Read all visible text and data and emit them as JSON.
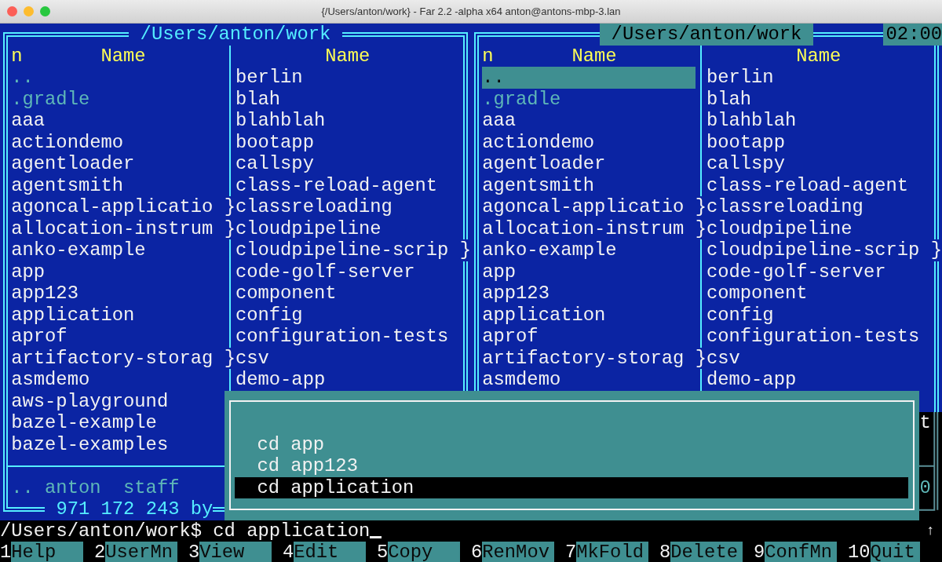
{
  "window": {
    "title": "{/Users/anton/work} - Far 2.2 -alpha x64 anton@antons-mbp-3.lan"
  },
  "panels": [
    {
      "title": "/Users/anton/work",
      "active": false,
      "columns": [
        {
          "sort_mark": "n",
          "header": "Name",
          "items": [
            {
              "name": "..",
              "dim": true,
              "selected": false
            },
            {
              "name": ".gradle",
              "dim": true,
              "selected": false
            },
            {
              "name": "aaa",
              "dim": false,
              "selected": false
            },
            {
              "name": "actiondemo",
              "dim": false,
              "selected": false
            },
            {
              "name": "agentloader",
              "dim": false,
              "selected": false
            },
            {
              "name": "agentsmith",
              "dim": false,
              "selected": false
            },
            {
              "name": "agoncal-applicatio",
              "dim": false,
              "selected": false,
              "overflow_mark": "}"
            },
            {
              "name": "allocation-instrum",
              "dim": false,
              "selected": false,
              "overflow_mark": "}"
            },
            {
              "name": "anko-example",
              "dim": false,
              "selected": false
            },
            {
              "name": "app",
              "dim": false,
              "selected": false
            },
            {
              "name": "app123",
              "dim": false,
              "selected": false
            },
            {
              "name": "application",
              "dim": false,
              "selected": false
            },
            {
              "name": "aprof",
              "dim": false,
              "selected": false
            },
            {
              "name": "artifactory-storag",
              "dim": false,
              "selected": false,
              "overflow_mark": "}"
            },
            {
              "name": "asmdemo",
              "dim": false,
              "selected": false
            },
            {
              "name": "aws-playground",
              "dim": false,
              "selected": false
            },
            {
              "name": "bazel-example",
              "dim": false,
              "selected": false
            },
            {
              "name": "bazel-examples",
              "dim": false,
              "selected": false
            }
          ]
        },
        {
          "header": "Name",
          "items": [
            {
              "name": "berlin",
              "dim": false,
              "selected": false
            },
            {
              "name": "blah",
              "dim": false,
              "selected": false
            },
            {
              "name": "blahblah",
              "dim": false,
              "selected": false
            },
            {
              "name": "bootapp",
              "dim": false,
              "selected": false
            },
            {
              "name": "callspy",
              "dim": false,
              "selected": false
            },
            {
              "name": "class-reload-agent",
              "dim": false,
              "selected": false
            },
            {
              "name": "classreloading",
              "dim": false,
              "selected": false
            },
            {
              "name": "cloudpipeline",
              "dim": false,
              "selected": false
            },
            {
              "name": "cloudpipeline-scrip",
              "dim": false,
              "selected": false,
              "overflow_mark": "}"
            },
            {
              "name": "code-golf-server",
              "dim": false,
              "selected": false
            },
            {
              "name": "component",
              "dim": false,
              "selected": false
            },
            {
              "name": "config",
              "dim": false,
              "selected": false
            },
            {
              "name": "configuration-tests",
              "dim": false,
              "selected": false
            },
            {
              "name": "csv",
              "dim": false,
              "selected": false
            },
            {
              "name": "demo-app",
              "dim": false,
              "selected": false
            }
          ]
        }
      ],
      "info": ".. anton  staff",
      "total": "971 172 243 by"
    },
    {
      "title": "/Users/anton/work",
      "active": true,
      "clock": "02:00",
      "columns": [
        {
          "sort_mark": "n",
          "header": "Name",
          "items": [
            {
              "name": "..",
              "dim": true,
              "selected": true
            },
            {
              "name": ".gradle",
              "dim": true,
              "selected": false
            },
            {
              "name": "aaa",
              "dim": false,
              "selected": false
            },
            {
              "name": "actiondemo",
              "dim": false,
              "selected": false
            },
            {
              "name": "agentloader",
              "dim": false,
              "selected": false
            },
            {
              "name": "agentsmith",
              "dim": false,
              "selected": false
            },
            {
              "name": "agoncal-applicatio",
              "dim": false,
              "selected": false,
              "overflow_mark": "}"
            },
            {
              "name": "allocation-instrum",
              "dim": false,
              "selected": false,
              "overflow_mark": "}"
            },
            {
              "name": "anko-example",
              "dim": false,
              "selected": false
            },
            {
              "name": "app",
              "dim": false,
              "selected": false
            },
            {
              "name": "app123",
              "dim": false,
              "selected": false
            },
            {
              "name": "application",
              "dim": false,
              "selected": false
            },
            {
              "name": "aprof",
              "dim": false,
              "selected": false
            },
            {
              "name": "artifactory-storag",
              "dim": false,
              "selected": false,
              "overflow_mark": "}"
            },
            {
              "name": "asmdemo",
              "dim": false,
              "selected": false
            }
          ]
        },
        {
          "header": "Name",
          "items": [
            {
              "name": "berlin",
              "dim": false,
              "selected": false
            },
            {
              "name": "blah",
              "dim": false,
              "selected": false
            },
            {
              "name": "blahblah",
              "dim": false,
              "selected": false
            },
            {
              "name": "bootapp",
              "dim": false,
              "selected": false
            },
            {
              "name": "callspy",
              "dim": false,
              "selected": false
            },
            {
              "name": "class-reload-agent",
              "dim": false,
              "selected": false
            },
            {
              "name": "classreloading",
              "dim": false,
              "selected": false
            },
            {
              "name": "cloudpipeline",
              "dim": false,
              "selected": false
            },
            {
              "name": "cloudpipeline-scrip",
              "dim": false,
              "selected": false,
              "overflow_mark": "}"
            },
            {
              "name": "code-golf-server",
              "dim": false,
              "selected": false
            },
            {
              "name": "component",
              "dim": false,
              "selected": false
            },
            {
              "name": "config",
              "dim": false,
              "selected": false
            },
            {
              "name": "configuration-tests",
              "dim": false,
              "selected": false
            },
            {
              "name": "csv",
              "dim": false,
              "selected": false
            },
            {
              "name": "demo-app",
              "dim": false,
              "selected": false
            }
          ]
        }
      ],
      "column_2_fragment": "t",
      "info_fragment": "0"
    }
  ],
  "history_dialog": {
    "items": [
      {
        "text": "cd app",
        "selected": false
      },
      {
        "text": "cd app123",
        "selected": false
      },
      {
        "text": "cd application",
        "selected": true
      }
    ]
  },
  "command_line": {
    "prompt": "/Users/anton/work$",
    "input": "cd application",
    "scroll_mark": "↑"
  },
  "keybar": [
    {
      "key": "1",
      "label": "Help"
    },
    {
      "key": "2",
      "label": "UserMn"
    },
    {
      "key": "3",
      "label": "View"
    },
    {
      "key": "4",
      "label": "Edit"
    },
    {
      "key": "5",
      "label": "Copy"
    },
    {
      "key": "6",
      "label": "RenMov"
    },
    {
      "key": "7",
      "label": "MkFold"
    },
    {
      "key": "8",
      "label": "Delete"
    },
    {
      "key": "9",
      "label": "ConfMn"
    },
    {
      "key": "10",
      "label": "Quit"
    }
  ]
}
